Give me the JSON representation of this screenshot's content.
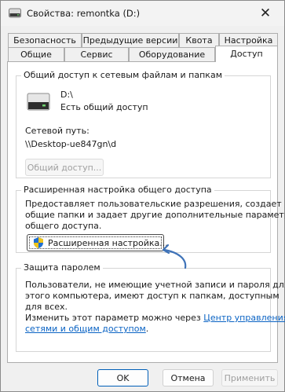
{
  "window": {
    "title": "Свойства: remontka (D:)"
  },
  "tabs_row1": [
    "Безопасность",
    "Предыдущие версии",
    "Квота",
    "Настройка"
  ],
  "tabs_row2": [
    "Общие",
    "Сервис",
    "Оборудование",
    "Доступ"
  ],
  "active_tab": "Доступ",
  "network_sharing": {
    "legend": "Общий доступ к сетевым файлам и папкам",
    "drive_name": "D:\\",
    "drive_status": "Есть общий доступ",
    "path_label": "Сетевой путь:",
    "path_value": "\\\\Desktop-ue847gn\\d",
    "share_button": "Общий доступ..."
  },
  "advanced_sharing": {
    "legend": "Расширенная настройка общего доступа",
    "description_lines": [
      "Предоставляет пользовательские разрешения, создает",
      "общие папки и задает другие дополнительные параметры",
      "общего доступа."
    ],
    "button": "Расширенная настройка..."
  },
  "password_protection": {
    "legend": "Защита паролем",
    "description_lines": [
      "Пользователи, не имеющие учетной записи и пароля для",
      "этого компьютера, имеют доступ к папкам, доступным",
      "для всех."
    ],
    "change_text": "Изменить этот параметр можно через",
    "link_line1": "Центр управления",
    "link_line2": "сетями и общим доступом",
    "link_suffix": "."
  },
  "footer": {
    "ok": "OK",
    "cancel": "Отмена",
    "apply": "Применить"
  },
  "colors": {
    "accent": "#005fb8",
    "annotation_arrow": "#3f73b8",
    "link": "#0a63c4"
  }
}
